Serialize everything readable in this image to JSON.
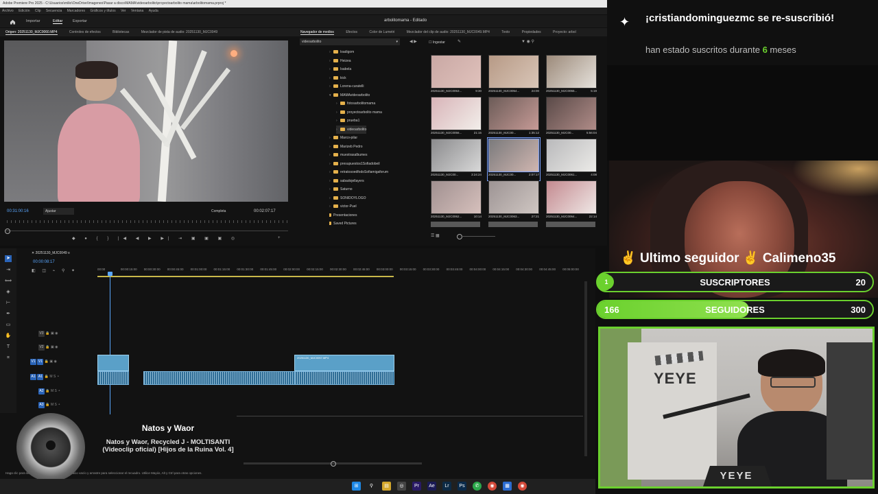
{
  "window": {
    "title": "Adobe Premiere Pro 2025 - C:\\Usuarios\\rnilio\\OneDrive\\Imagenes\\Pasar a disco\\MAMA\\videoarbolito\\proyectoarbolito mama\\arbolitomama.prproj *",
    "menu": [
      "Archivo",
      "Edición",
      "Clip",
      "Secuencia",
      "Marcadores",
      "Gráficos y títulos",
      "Ver",
      "Ventana",
      "Ayuda"
    ],
    "nav_tabs": [
      "Importar",
      "Editar",
      "Exportar"
    ],
    "workspace_title": "arbolitomama - Editado"
  },
  "left_panel": {
    "tabs": [
      "Origen: 20251130_MJC0060.MP4",
      "Controles de efectos",
      "Bibliotecas",
      "Mezclador de pista de audio: 20251130_MJC0049"
    ],
    "timecode_in": "00:31:00:16",
    "fit": "Ajustar",
    "quality": "Completa",
    "timecode_out": "00:02:07:17"
  },
  "right_panel": {
    "tabs": [
      "Navegador de medios",
      "Efectos",
      "Color de Lumetri",
      "Mezclador del clip de audio: 20251130_MJC0049.MP4",
      "Texto",
      "Propiedades",
      "Proyecto: arbol"
    ],
    "path_select": "videoarbolito",
    "ingest_label": "Ingestar",
    "folders": [
      {
        "name": "loadigom",
        "indent": 0,
        "open": false
      },
      {
        "name": "Heizea",
        "indent": 0,
        "open": false
      },
      {
        "name": "Isabela",
        "indent": 0,
        "open": false
      },
      {
        "name": "kick",
        "indent": 0,
        "open": false
      },
      {
        "name": "Lorena-curatelli",
        "indent": 0,
        "open": false
      },
      {
        "name": "MAMAvideoarbolito",
        "indent": 0,
        "open": true
      },
      {
        "name": "fotosarbolitomama",
        "indent": 1,
        "open": false
      },
      {
        "name": "proyectoarbolito mama",
        "indent": 1,
        "open": false
      },
      {
        "name": "prueba1",
        "indent": 1,
        "open": false
      },
      {
        "name": "videoarbolito",
        "indent": 1,
        "open": false
      },
      {
        "name": "Marco-pilar",
        "indent": 0,
        "open": false
      },
      {
        "name": "Marizeb Pedro",
        "indent": 0,
        "open": false
      },
      {
        "name": "muestrasalbumes",
        "indent": 0,
        "open": false
      },
      {
        "name": "presupuestos1Sofiadobeil",
        "indent": 0,
        "open": false
      },
      {
        "name": "retratosoedfodoSofiamigaforum",
        "indent": 0,
        "open": false
      },
      {
        "name": "sabadojellayers",
        "indent": 0,
        "open": false
      },
      {
        "name": "Saturno",
        "indent": 0,
        "open": false
      },
      {
        "name": "SONIDOYLOGO",
        "indent": 0,
        "open": false
      },
      {
        "name": "victor-Puel",
        "indent": 0,
        "open": false
      },
      {
        "name": "Presentaciones",
        "indent": -1,
        "open": false
      },
      {
        "name": "Saved Pictures",
        "indent": -1,
        "open": false
      }
    ],
    "thumbnails": [
      {
        "name": "20251130_MJC0053...",
        "dur": "9:30"
      },
      {
        "name": "20251130_MJC0054...",
        "dur": "24:00"
      },
      {
        "name": "20251130_MJC0055...",
        "dur": "5:19"
      },
      {
        "name": "20251130_MJC0056...",
        "dur": "21:15"
      },
      {
        "name": "20251130_MJC00...",
        "dur": "1:35:12"
      },
      {
        "name": "20251130_MJC00...",
        "dur": "5:56:04"
      },
      {
        "name": "20251130_MJC00...",
        "dur": "3:24:24"
      },
      {
        "name": "20251130_MJC00...",
        "dur": "2:07:17"
      },
      {
        "name": "20251130_MJC0061...",
        "dur": "4:08"
      },
      {
        "name": "20251130_MJC0062...",
        "dur": "10:14"
      },
      {
        "name": "20251130_MJC0063...",
        "dur": "27:21"
      },
      {
        "name": "20251130_MJC0064...",
        "dur": "22:14"
      }
    ]
  },
  "timeline": {
    "sequence": "20251130_MJC0049",
    "timecode": "00:00:08:17",
    "ruler": [
      "00:00",
      "00:00:15:00",
      "00:00:30:00",
      "00:00:45:00",
      "00:01:00:00",
      "00:01:15:00",
      "00:01:30:00",
      "00:01:45:00",
      "00:02:00:00",
      "00:02:15:00",
      "00:02:30:00",
      "00:02:45:00",
      "00:03:00:00",
      "00:03:15:00",
      "00:03:30:00",
      "00:03:45:00",
      "00:04:00:00",
      "00:04:15:00",
      "00:04:30:00",
      "00:04:45:00",
      "00:05:00:00"
    ],
    "tracks": [
      "V3",
      "V2",
      "V1",
      "A1",
      "A2",
      "A3"
    ],
    "clip_label": "20251130_MJC0057.MP4",
    "status": "Haga clic para seleccionar, o haga clic en un espacio vacío y arrastre para seleccionar el recuadro. Utilice Mayús, Alt y Ctrl para otras opciones."
  },
  "music": {
    "artist": "Natos y Waor",
    "title": "Natos y Waor, Recycled J - MOLTISANTI (Videoclip oficial) [Hijos de la Ruina Vol. 4]"
  },
  "overlay": {
    "notif_line1": "¡cristiandominguezmc se re-suscribió!",
    "notif_line2_pre": "han estado suscritos durante",
    "notif_months": "6",
    "notif_line2_post": "meses",
    "last_follower_label": "Ultimo seguidor",
    "last_follower_name": "Calimeno35",
    "subs_badge": "1",
    "subs_label": "SUSCRIPTORES",
    "subs_goal": "20",
    "subs_progress": 0.05,
    "followers_value": "166",
    "followers_label": "SEGUIDORES",
    "followers_goal": "300",
    "followers_progress": 0.55,
    "poster_text": "YEYE",
    "cam_brand": "YEYE",
    "accent": "#6bd12e"
  }
}
